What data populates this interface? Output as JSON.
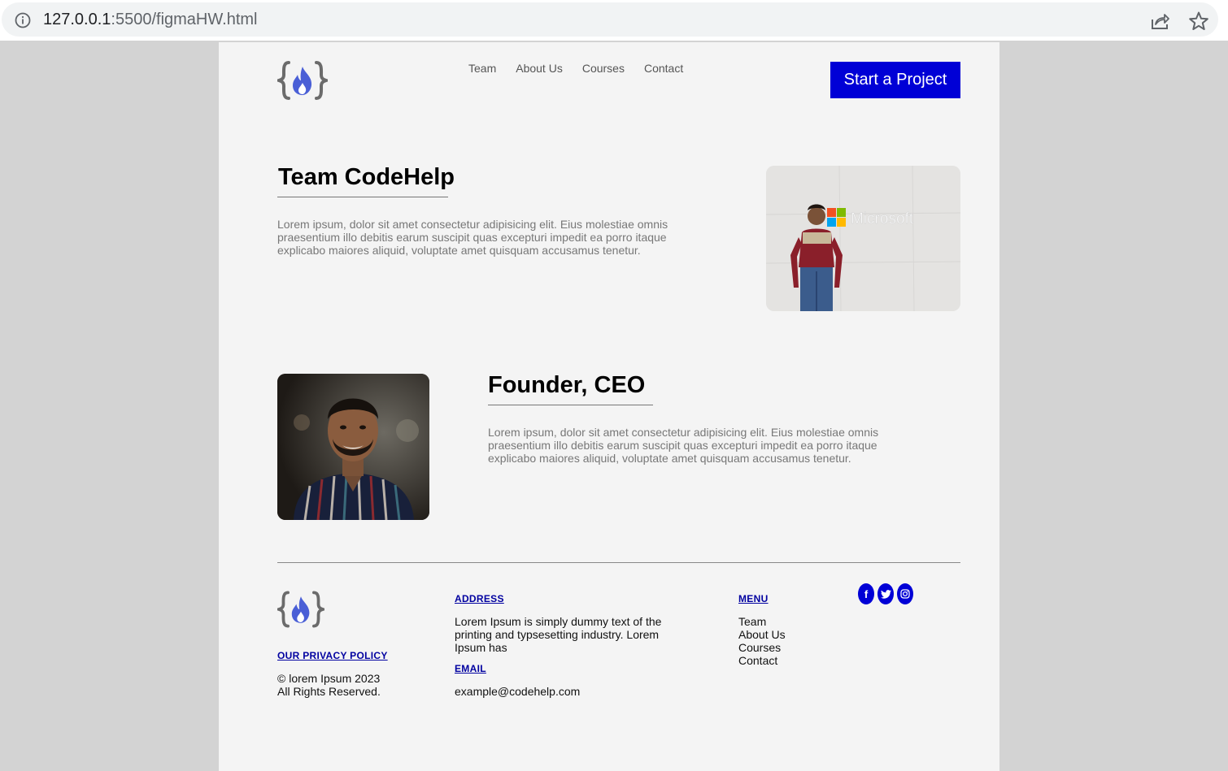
{
  "browser": {
    "url_host": "127.0.0.1",
    "url_path": ":5500/figmaHW.html"
  },
  "header": {
    "nav": [
      "Team",
      "About Us",
      "Courses",
      "Contact"
    ],
    "cta_label": "Start a Project"
  },
  "team_section": {
    "title": "Team CodeHelp",
    "text": "Lorem ipsum, dolor sit amet consectetur adipisicing elit. Eius molestiae omnis praesentium illo debitis earum suscipit quas excepturi impedit ea porro itaque explicabo maiores aliquid, voluptate amet quisquam accusamus tenetur.",
    "photo_sign": "Microsoft"
  },
  "founder_section": {
    "title": "Founder, CEO",
    "text": "Lorem ipsum, dolor sit amet consectetur adipisicing elit. Eius molestiae omnis praesentium illo debitis earum suscipit quas excepturi impedit ea porro itaque explicabo maiores aliquid, voluptate amet quisquam accusamus tenetur."
  },
  "footer": {
    "privacy_label": "OUR PRIVACY POLICY",
    "copyright": "© lorem Ipsum 2023",
    "rights": "All Rights Reserved.",
    "address_heading": "ADDRESS",
    "address_text": "Lorem Ipsum is simply dummy text of the printing and typsesetting industry. Lorem Ipsum has",
    "email_heading": "EMAIL",
    "email": "example@codehelp.com",
    "menu_heading": "MENU",
    "menu": [
      "Team",
      "About Us",
      "Courses",
      "Contact"
    ],
    "socials": [
      {
        "icon": "facebook-icon",
        "glyph": "f"
      },
      {
        "icon": "twitter-icon",
        "glyph": "t"
      },
      {
        "icon": "instagram-icon",
        "glyph": "◎"
      }
    ]
  },
  "colors": {
    "accent": "#0000d6",
    "page_bg": "#f4f4f4",
    "outer_bg": "#d3d3d3",
    "logo_brace": "#6b6b6b",
    "logo_flame": "#4a5fd6"
  }
}
